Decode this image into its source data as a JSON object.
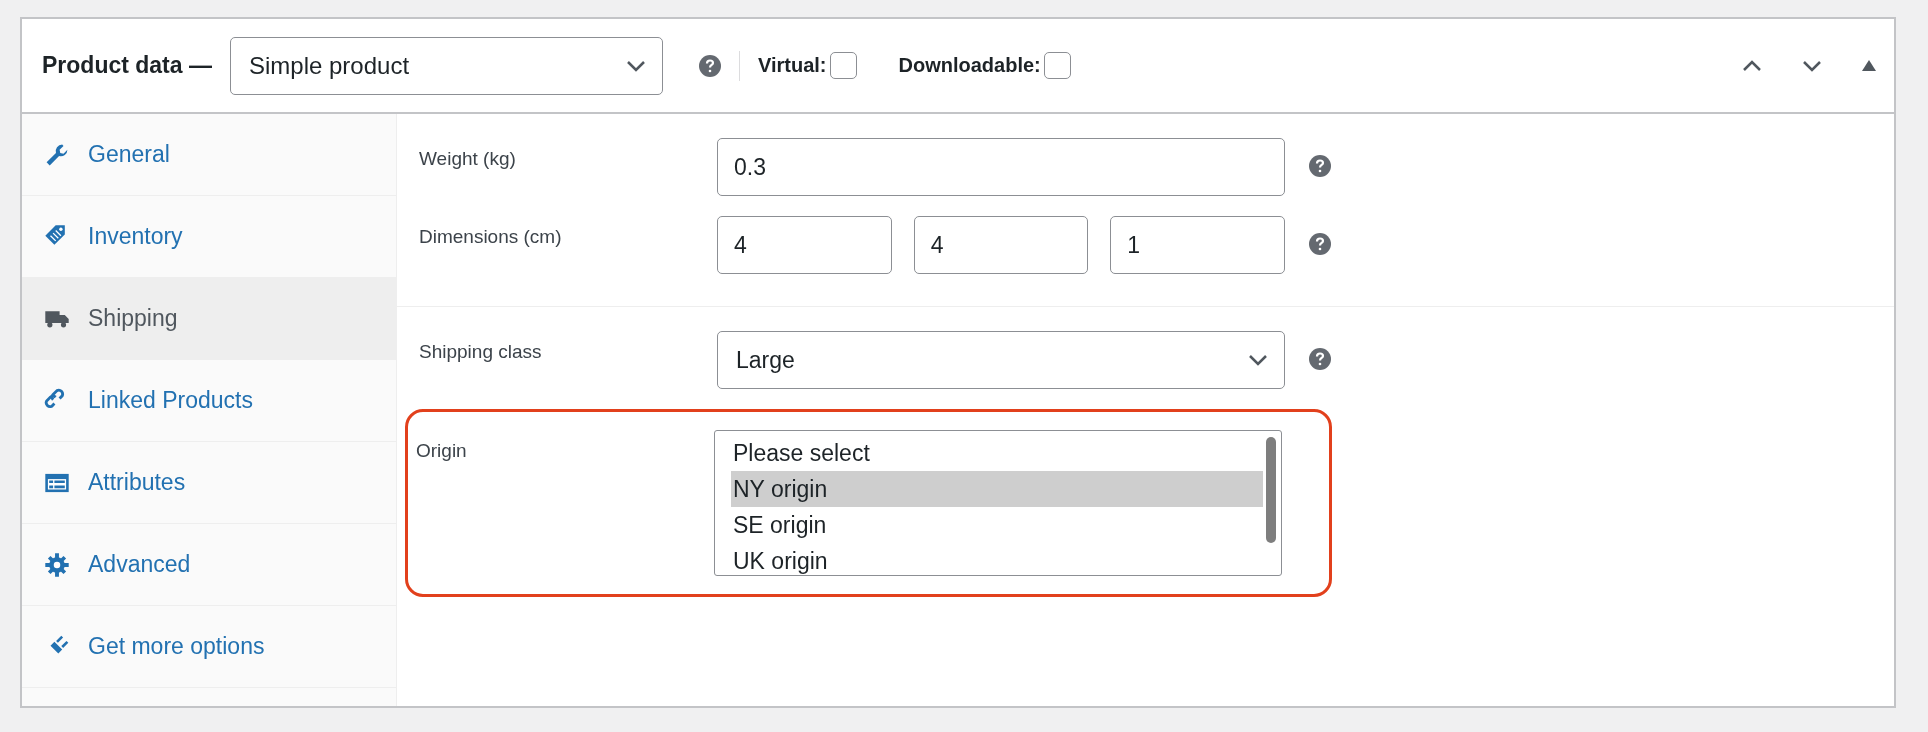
{
  "header": {
    "title": "Product data —",
    "product_type": "Simple product",
    "options": [
      {
        "label": "Virtual:",
        "checked": false
      },
      {
        "label": "Downloadable:",
        "checked": false
      }
    ]
  },
  "tabs": [
    {
      "label": "General",
      "selected": false
    },
    {
      "label": "Inventory",
      "selected": false
    },
    {
      "label": "Shipping",
      "selected": true
    },
    {
      "label": "Linked Products",
      "selected": false
    },
    {
      "label": "Attributes",
      "selected": false
    },
    {
      "label": "Advanced",
      "selected": false
    },
    {
      "label": "Get more options",
      "selected": false
    }
  ],
  "groups": [
    {
      "fields": [
        {
          "kind": "inputs",
          "label": "Weight (kg)",
          "values": [
            "0.3"
          ]
        },
        {
          "kind": "inputs",
          "label": "Dimensions (cm)",
          "values": [
            "4",
            "4",
            "1"
          ]
        }
      ]
    },
    {
      "fields": [
        {
          "kind": "select",
          "label": "Shipping class",
          "value": "Large"
        },
        {
          "kind": "listbox",
          "label": "Origin",
          "highlighted": true,
          "options": [
            {
              "label": "Please select",
              "selected": false
            },
            {
              "label": "NY origin",
              "selected": true
            },
            {
              "label": "SE origin",
              "selected": false
            },
            {
              "label": "UK origin",
              "selected": false
            }
          ]
        }
      ]
    }
  ]
}
